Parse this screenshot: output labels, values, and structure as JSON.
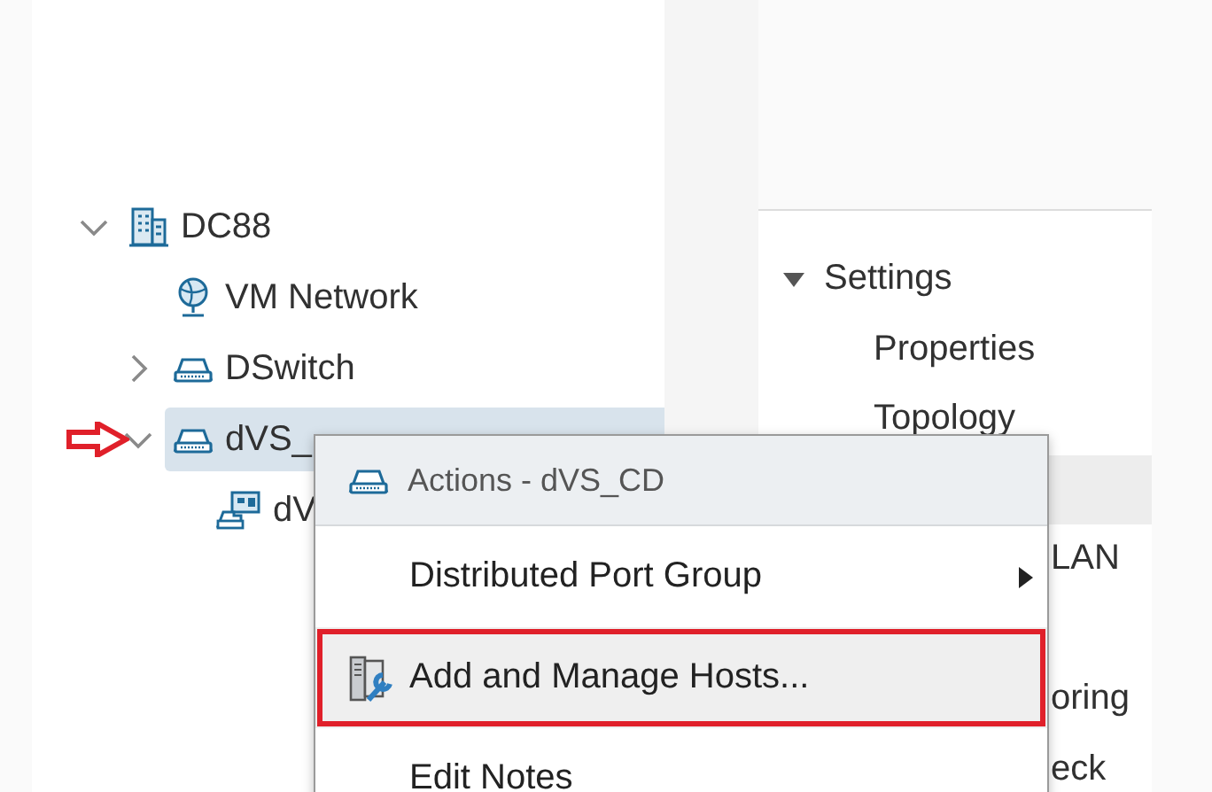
{
  "tree": [
    {
      "label": "DC88",
      "kind": "datacenter",
      "expanded": true,
      "selected": false,
      "children": [
        {
          "label": "VM Network",
          "kind": "network",
          "selected": false
        },
        {
          "label": "DSwitch",
          "kind": "switch",
          "expanded": false,
          "selected": false
        },
        {
          "label": "dVS_",
          "kind": "switch",
          "expanded": true,
          "selected": true,
          "marked": true,
          "children": [
            {
              "label": "dV",
              "kind": "portgroup",
              "selected": false
            }
          ]
        }
      ]
    }
  ],
  "settings_panel": {
    "section": {
      "label": "Settings",
      "expanded": true
    },
    "items": [
      {
        "kind": "item",
        "label": "Properties",
        "selected": false
      },
      {
        "kind": "item",
        "label": "Topology",
        "selected": false
      },
      {
        "kind": "blank",
        "selected": true
      },
      {
        "kind": "fragment",
        "label": "LAN",
        "selected": false
      },
      {
        "kind": "spaced_fragment",
        "label": "oring",
        "selected": false
      },
      {
        "kind": "fragment",
        "label": "eck",
        "selected": false
      }
    ]
  },
  "context_menu": {
    "header": {
      "label": "Actions - dVS_CD"
    },
    "items": [
      {
        "label": "Distributed Port Group",
        "kind": "plain",
        "submenu": true,
        "highlighted": false,
        "marked": false
      },
      {
        "label": "Add and Manage Hosts...",
        "kind": "hosts",
        "submenu": false,
        "highlighted": true,
        "marked": true
      },
      {
        "label": "Edit Notes",
        "kind": "plain",
        "submenu": false,
        "highlighted": false,
        "marked": false
      }
    ]
  }
}
